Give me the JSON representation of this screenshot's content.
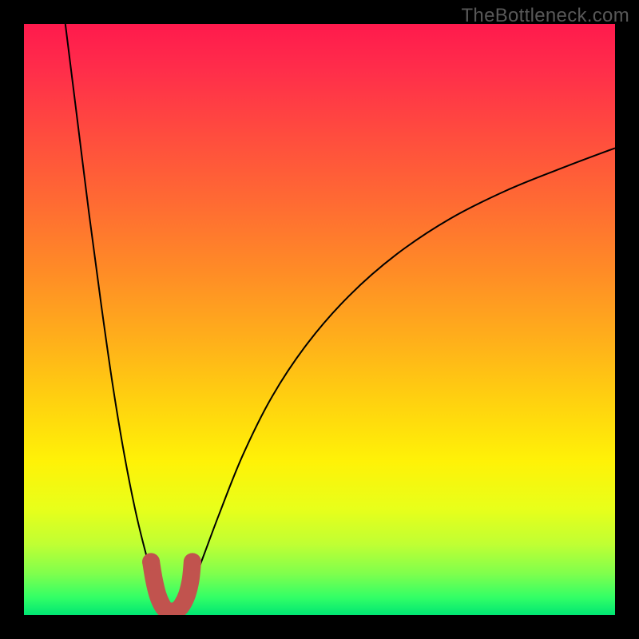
{
  "watermark": "TheBottleneck.com",
  "chart_data": {
    "type": "line",
    "title": "",
    "xlabel": "",
    "ylabel": "",
    "xlim": [
      0,
      100
    ],
    "ylim": [
      0,
      100
    ],
    "background_gradient": {
      "direction": "vertical",
      "stops": [
        {
          "pos": 0,
          "color": "#ff1a4d"
        },
        {
          "pos": 50,
          "color": "#ff9a20"
        },
        {
          "pos": 75,
          "color": "#fff208"
        },
        {
          "pos": 100,
          "color": "#00e673"
        }
      ]
    },
    "series": [
      {
        "name": "curve-left",
        "x": [
          7,
          9,
          11,
          13,
          15,
          17,
          19,
          21,
          22.5,
          23.5
        ],
        "y": [
          100,
          84,
          68,
          53,
          39,
          27,
          17,
          9,
          4,
          1
        ],
        "stroke": "#000000",
        "stroke_width": 2
      },
      {
        "name": "curve-right",
        "x": [
          26.5,
          28,
          30,
          33,
          37,
          42,
          48,
          55,
          63,
          72,
          82,
          92,
          100
        ],
        "y": [
          1,
          4,
          9,
          17,
          27,
          37,
          46,
          54,
          61,
          67,
          72,
          76,
          79
        ],
        "stroke": "#000000",
        "stroke_width": 2
      },
      {
        "name": "valley-fill",
        "type": "area",
        "x": [
          21.5,
          22.0,
          22.6,
          23.3,
          24.0,
          25.0,
          26.0,
          26.8,
          27.6,
          28.2,
          28.5
        ],
        "y": [
          9.0,
          6.0,
          3.5,
          1.8,
          0.9,
          0.6,
          0.9,
          1.8,
          3.5,
          6.0,
          9.0
        ],
        "fill": "#c1534e",
        "stroke": "#c1534e",
        "stroke_width": 12
      }
    ],
    "annotations": []
  }
}
